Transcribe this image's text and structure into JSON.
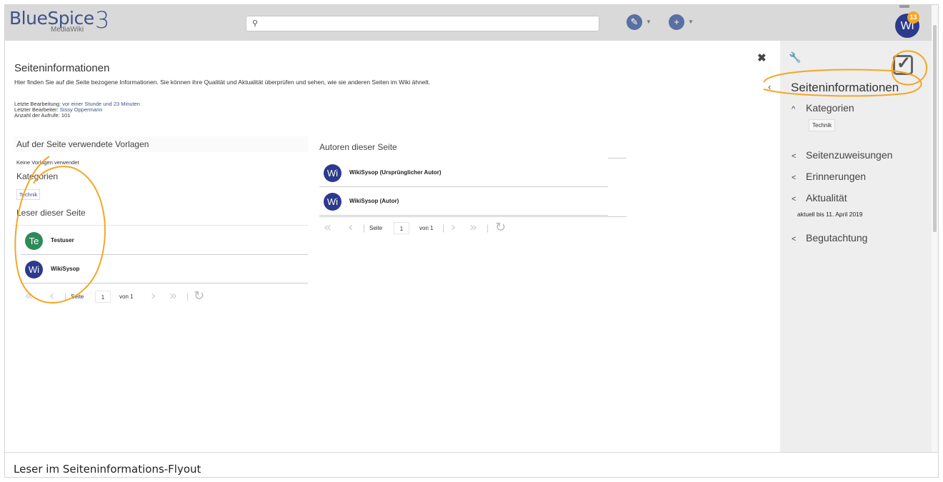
{
  "topbar": {
    "logo_brand": "BlueSpice",
    "logo_sub": "MediaWiki",
    "logo_version": "3",
    "search_icon": "search-icon",
    "edit_icon": "pencil-icon",
    "add_icon": "plus-icon",
    "avatar_initials": "Wi",
    "notification_count": "13"
  },
  "main": {
    "title": "Seiteninformationen",
    "description": "Hier finden Sie auf die Seite bezogene Informationen. Sie können ihre Qualität und Aktualität überprüfen und sehen, wie sie anderen Seiten im Wiki ähnelt.",
    "last_edit_label": "Letzte Bearbeitung:",
    "last_edit_value": "vor einer Stunde und 23 Minuten",
    "last_editor_label": "Letzter Bearbeiter:",
    "last_editor_value": "Sissy Oppermann",
    "views_label": "Anzahl der Aufrufe: 101",
    "templates_header": "Auf der Seite verwendete Vorlagen",
    "templates_none": "Keine Vorlagen verwendet",
    "categories_header": "Kategorien",
    "category_tag": "Technik",
    "readers_header": "Leser dieser Seite",
    "readers": [
      {
        "initials": "Te",
        "name": "Testuser",
        "color": "#2e8b57"
      },
      {
        "initials": "Wi",
        "name": "WikiSysop",
        "color": "#2b3a8c"
      }
    ],
    "authors_header": "Autoren dieser Seite",
    "authors": [
      {
        "initials": "Wi",
        "name": "WikiSysop (Ursprünglicher Autor)",
        "color": "#2b3a8c"
      },
      {
        "initials": "Wi",
        "name": "WikiSysop (Autor)",
        "color": "#2b3a8c"
      }
    ],
    "pager": {
      "first": "«",
      "prev": "‹",
      "page_label": "Seite",
      "page_value": "1",
      "of_label": "von 1",
      "next": "›",
      "last": "»",
      "refresh": "↻"
    },
    "pager_readers": {
      "page_label": "Seite",
      "page_value": "1",
      "of_label": "von 1"
    }
  },
  "flyout": {
    "title": "Seiteninformationen",
    "items": [
      {
        "label": "Kategorien",
        "chevron": "^"
      },
      {
        "label": "Seitenzuweisungen",
        "chevron": "<"
      },
      {
        "label": "Erinnerungen",
        "chevron": "<"
      },
      {
        "label": "Aktualität",
        "chevron": "<"
      },
      {
        "label": "Begutachtung",
        "chevron": "<"
      }
    ],
    "category_tag": "Technik",
    "actuality_note": "aktuell bis 11. April 2019"
  },
  "caption": "Leser im Seiteninformations-Flyout",
  "colors": {
    "accent": "#f5a623",
    "brand": "#3e5389"
  }
}
